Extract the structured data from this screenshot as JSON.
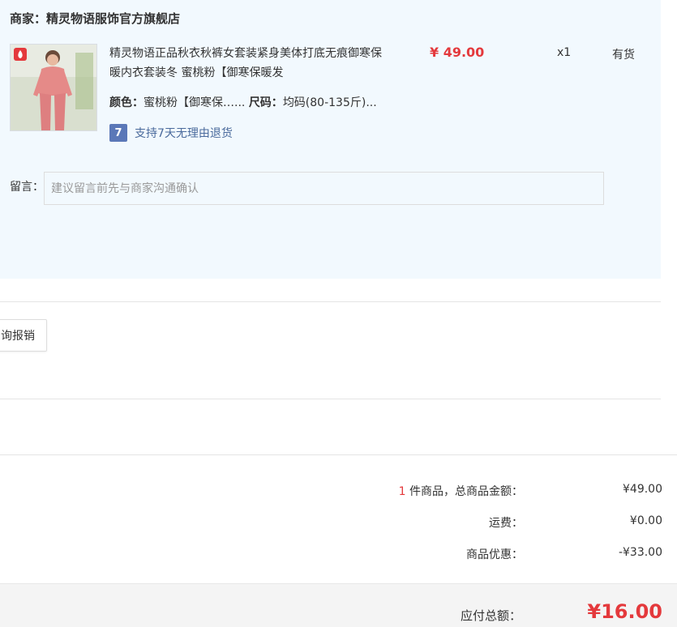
{
  "store": {
    "merchant_label": "商家：",
    "merchant_name": "精灵物语服饰官方旗舰店"
  },
  "product": {
    "image": "product-photo-pink-thermal-set",
    "title": "精灵物语正品秋衣秋裤女套装紧身美体打底无痕御寒保暖内衣套装冬 蜜桃粉【御寒保暖发",
    "color_label": "颜色：",
    "color_value": "蜜桃粉【御寒保暖发热】",
    "size_label": "尺码：",
    "size_value": "均码(80-135斤)",
    "return_icon": "7-day-return-icon",
    "return_icon_text": "7",
    "return_text": "支持7天无理由退货",
    "price": "¥ 49.00",
    "quantity": "x1",
    "stock": "有货"
  },
  "note": {
    "label": "留言：",
    "placeholder": "建议留言前先与商家沟通确认"
  },
  "invoice": {
    "button_label": "询报销"
  },
  "summary": {
    "count": "1",
    "items_label": " 件商品，总商品金额：",
    "items_value": "¥49.00",
    "shipping_label": "运费：",
    "shipping_value": "¥0.00",
    "discount_label": "商品优惠：",
    "discount_value": "-¥33.00"
  },
  "total": {
    "label": "应付总额：",
    "value": "¥16.00"
  },
  "colors": {
    "accent_red": "#e4393c",
    "store_bg": "#f2f9fe",
    "return_badge": "#5b78b8"
  }
}
